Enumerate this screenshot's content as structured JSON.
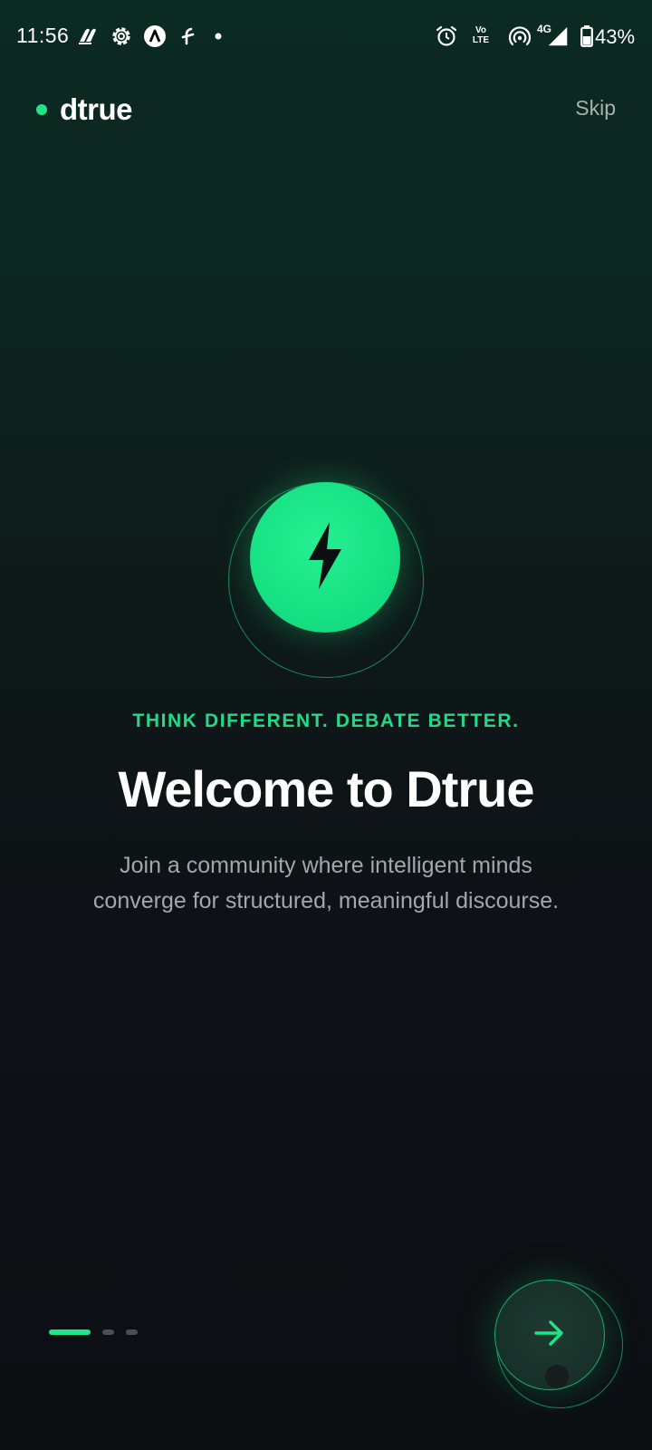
{
  "status_bar": {
    "time": "11:56",
    "left_icons": [
      "stylus-icon",
      "gear-icon",
      "a-badge-icon",
      "flash-app-icon",
      "dot-icon"
    ],
    "right_icons": [
      "alarm-icon",
      "volte-icon",
      "hotspot-icon",
      "signal-4g-icon",
      "battery-icon"
    ],
    "volte_label_top": "Vo",
    "volte_label_bottom": "LTE",
    "network_label": "4G",
    "battery_percent": "43%"
  },
  "header": {
    "brand_name": "dtrue",
    "skip_label": "Skip"
  },
  "hero": {
    "icon": "lightning-bolt-icon"
  },
  "content": {
    "tagline": "THINK DIFFERENT. DEBATE BETTER.",
    "title": "Welcome to Dtrue",
    "subtitle": "Join a community where intelligent minds converge for structured, meaningful discourse."
  },
  "pager": {
    "total_pages": 3,
    "current_page": 1
  },
  "next_button": {
    "icon": "arrow-right-icon"
  },
  "colors": {
    "accent": "#1de58a",
    "tagline": "#22d98a",
    "subtitle": "#a2a7ad",
    "skip": "#a9b1ad",
    "background_top": "#0b2a22",
    "background_bottom": "#0c0e12"
  }
}
